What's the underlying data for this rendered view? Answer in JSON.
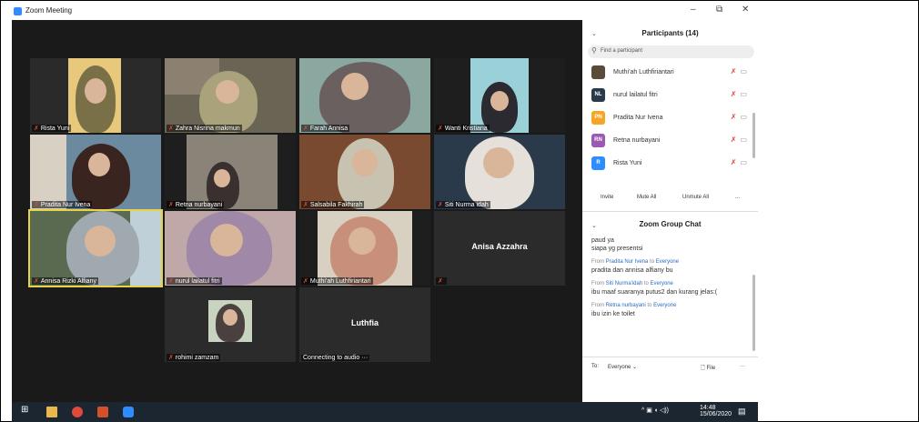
{
  "window": {
    "title": "Zoom Meeting",
    "min": "–",
    "restore": "⧉",
    "close": "✕"
  },
  "tiles": [
    {
      "name": "Rista Yuni"
    },
    {
      "name": "Zahra Nisrina makmun"
    },
    {
      "name": "Farah Annisa"
    },
    {
      "name": "Wanti Kristiana"
    },
    {
      "name": "Pradita Nur Ivena"
    },
    {
      "name": "Retna nurbayani"
    },
    {
      "name": "Salsabila Fakhirah"
    },
    {
      "name": "Siti Nurma idah"
    },
    {
      "name": "Annisa Rizki Alfiany"
    },
    {
      "name": "nurul lailatul fitri"
    },
    {
      "name": "Muthi'ah Luthfiriantari"
    },
    {
      "name": "Anisa Azzahra"
    },
    {
      "name": "rohimi zamzam"
    },
    {
      "name": "Luthfia",
      "status": "Connecting to audio ···"
    }
  ],
  "participants": {
    "header": "Participants (14)",
    "search_placeholder": "Find a participant",
    "items": [
      {
        "name": "Muthi'ah Luthfiriantari",
        "initials": "",
        "color": "#5a4a3a"
      },
      {
        "name": "nurul lailatul fitri",
        "initials": "NL",
        "color": "#2b3a4a"
      },
      {
        "name": "Pradita Nur Ivena",
        "initials": "PN",
        "color": "#f5a623"
      },
      {
        "name": "Retna nurbayani",
        "initials": "RN",
        "color": "#9b59b6"
      },
      {
        "name": "Rista Yuni",
        "initials": "R",
        "color": "#2d8cff"
      }
    ],
    "invite": "Invite",
    "mute_all": "Mute All",
    "unmute_all": "Unmute All",
    "more": "..."
  },
  "chat": {
    "header": "Zoom Group Chat",
    "lines": [
      "paud ya",
      "siapa yg presentsi"
    ],
    "messages": [
      {
        "from": "Pradita Nur Ivena",
        "to": "Everyone",
        "text": "pradita dan annisa alfiany bu"
      },
      {
        "from": "Siti Nurma'idah",
        "to": "Everyone",
        "text": "ibu maaf suaranya putus2 dan kurang jelas:("
      },
      {
        "from": "Retna nurbayani",
        "to": "Everyone",
        "text": "ibu izin ke toilet"
      }
    ],
    "from_label": "From",
    "to_word": "to",
    "to_label": "To:",
    "recipient": "Everyone ⌄",
    "file": "File",
    "more": "···"
  },
  "taskbar": {
    "time": "14:48",
    "date": "15/06/2020"
  }
}
